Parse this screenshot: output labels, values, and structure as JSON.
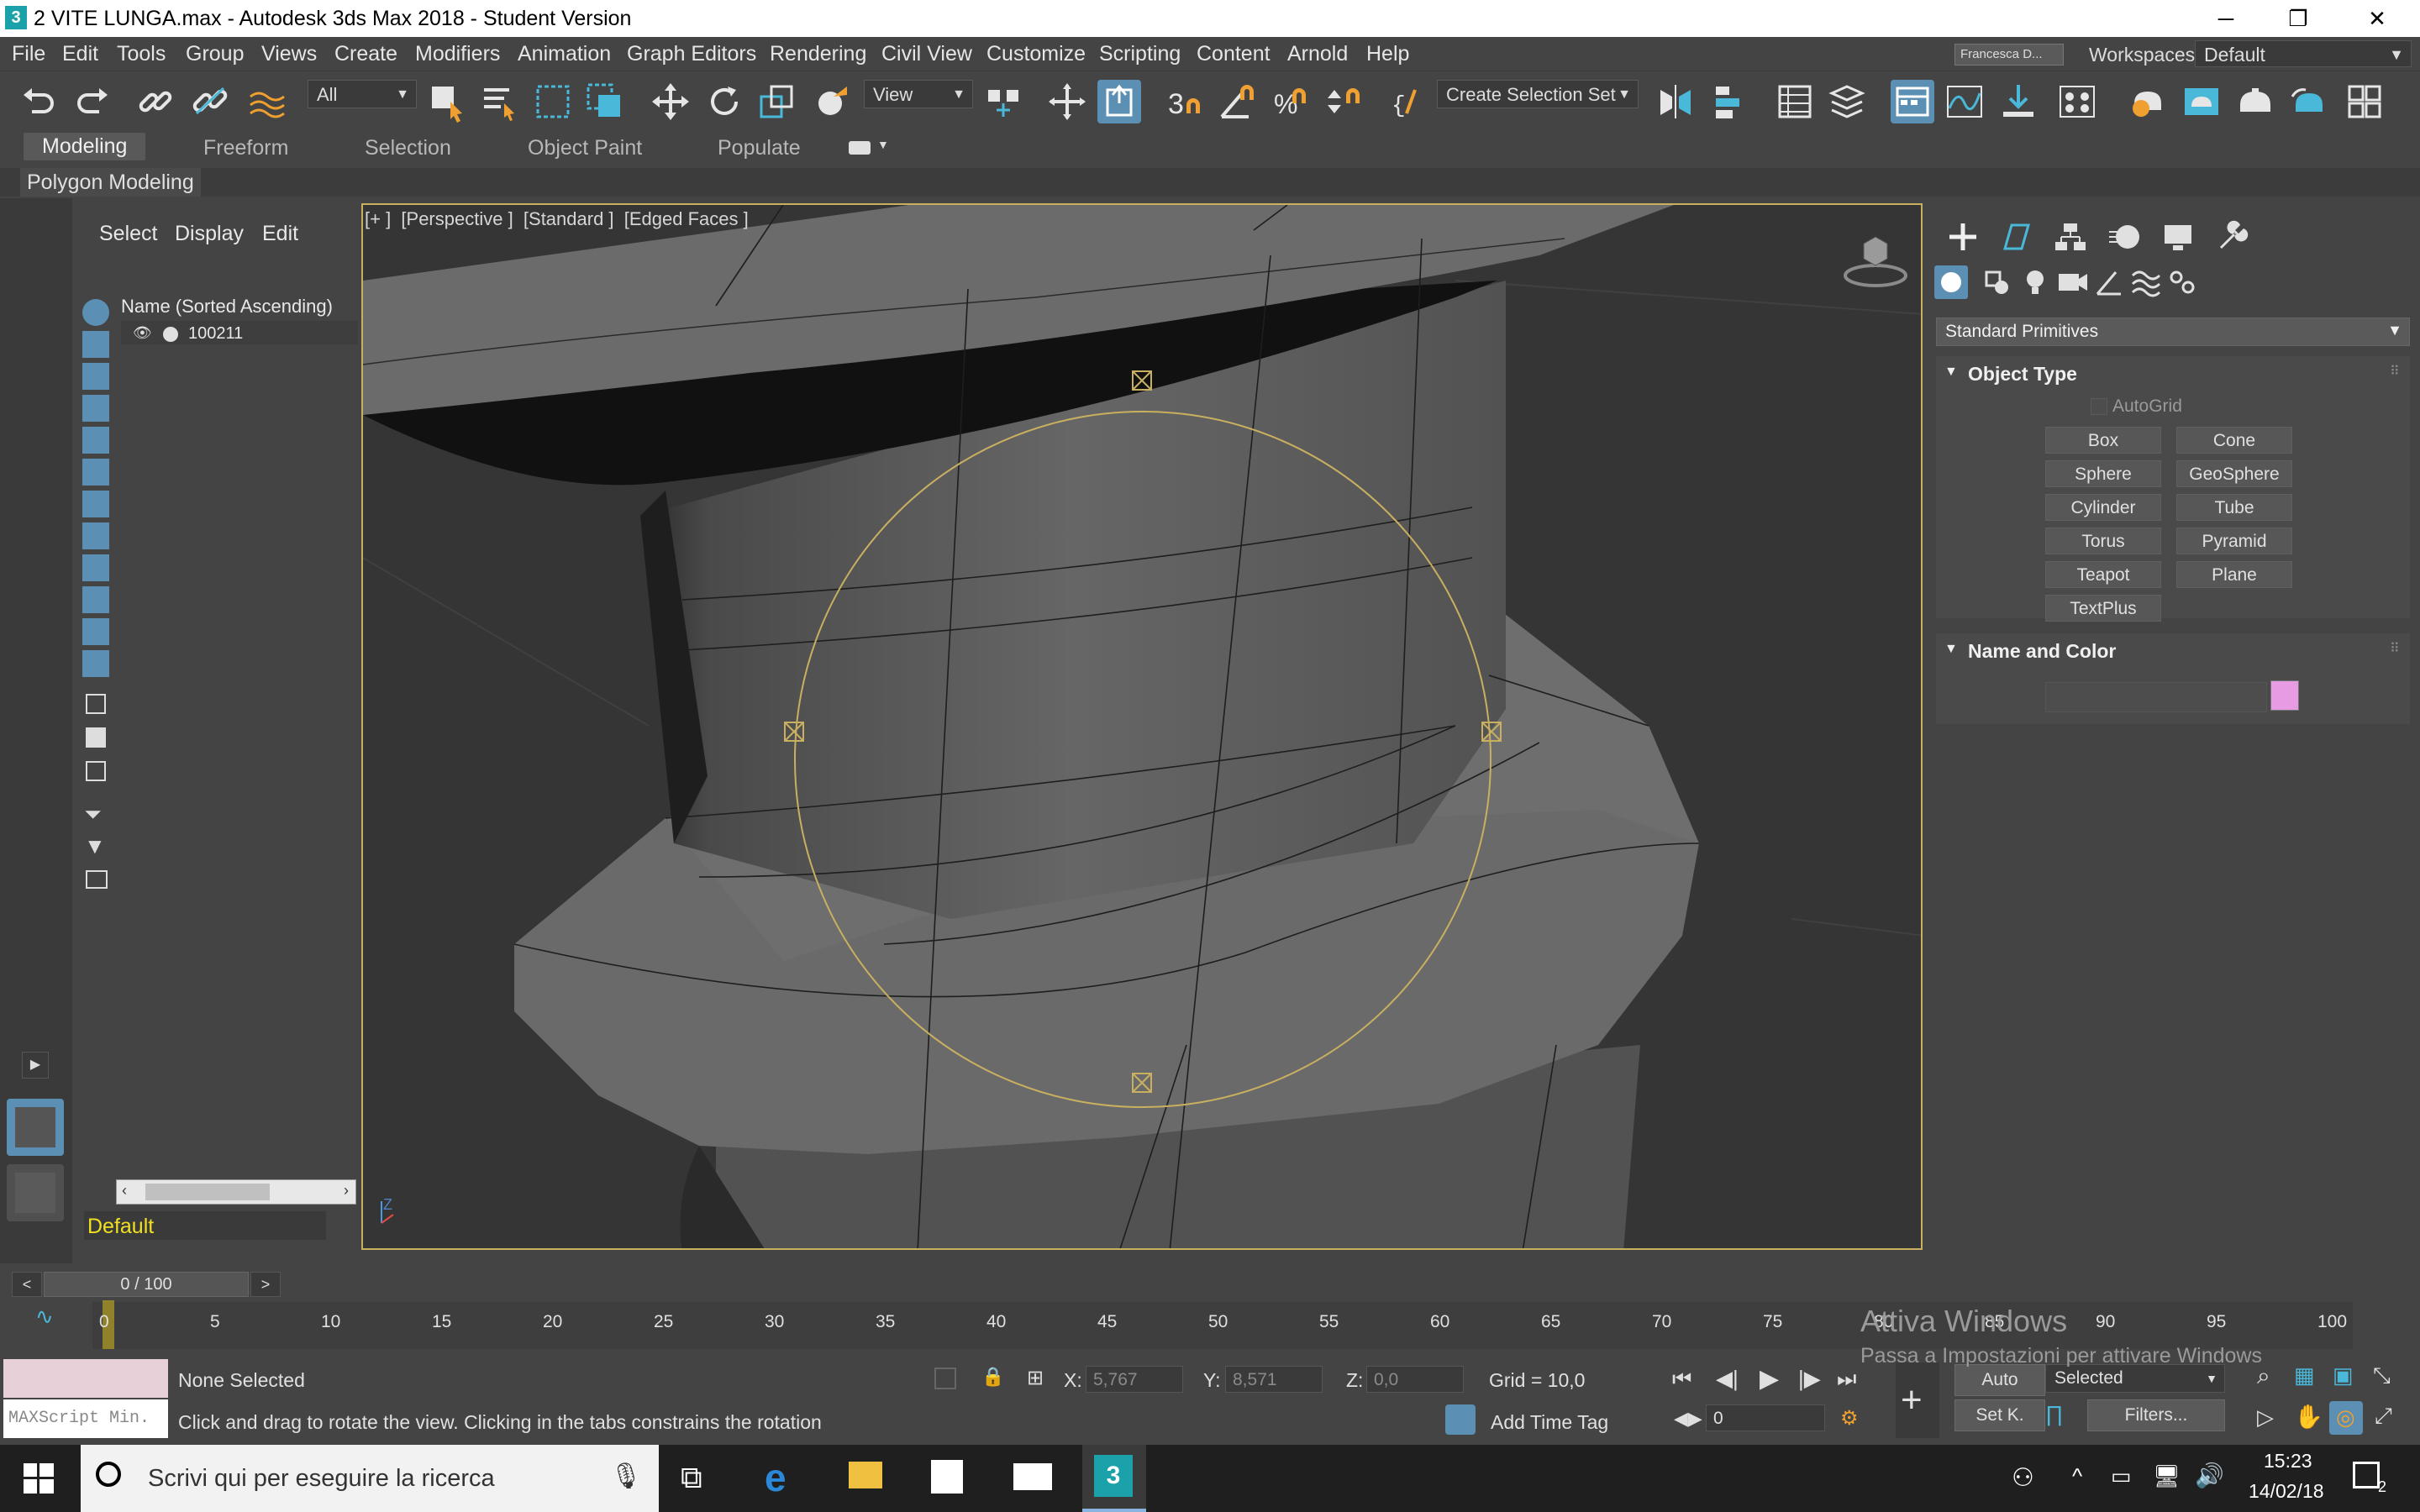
{
  "window": {
    "title": "2 VITE LUNGA.max - Autodesk 3ds Max 2018 - Student Version",
    "app_icon": "3",
    "min": "─",
    "restore": "❐",
    "close": "✕"
  },
  "menu": [
    "File",
    "Edit",
    "Tools",
    "Group",
    "Views",
    "Create",
    "Modifiers",
    "Animation",
    "Graph Editors",
    "Rendering",
    "Civil View",
    "Customize",
    "Scripting",
    "Content",
    "Arnold",
    "Help"
  ],
  "user": "Francesca D...",
  "workspaces": {
    "label": "Workspaces:",
    "value": "Default"
  },
  "toolbar": {
    "filter": "All",
    "refcoord": "View",
    "selection_set": "Create Selection Set"
  },
  "ribbon": {
    "tabs": [
      "Modeling",
      "Freeform",
      "Selection",
      "Object Paint",
      "Populate"
    ],
    "active": "Modeling",
    "sub": "Polygon Modeling"
  },
  "scene_explorer": {
    "tabs": [
      "Select",
      "Display",
      "Edit"
    ],
    "header": "Name (Sorted Ascending)",
    "items": [
      "100211"
    ],
    "layer": "Default"
  },
  "viewport": {
    "label": "[+ ]  [Perspective ]  [Standard ]  [Edged Faces ]"
  },
  "command_panel": {
    "category": "Standard Primitives",
    "object_type_title": "Object Type",
    "autogrid": "AutoGrid",
    "buttons": [
      "Box",
      "Cone",
      "Sphere",
      "GeoSphere",
      "Cylinder",
      "Tube",
      "Torus",
      "Pyramid",
      "Teapot",
      "Plane",
      "TextPlus"
    ],
    "name_color_title": "Name and Color",
    "swatch_color": "#e79be3"
  },
  "timeline": {
    "frame": "0 / 100",
    "ticks": [
      "0",
      "5",
      "10",
      "15",
      "20",
      "25",
      "30",
      "35",
      "40",
      "45",
      "50",
      "55",
      "60",
      "65",
      "70",
      "75",
      "80",
      "85",
      "90",
      "95",
      "100"
    ]
  },
  "status": {
    "maxscript": "MAXScript Min.",
    "selection": "None Selected",
    "prompt": "Click and drag to rotate the view.  Clicking in the tabs constrains the rotation",
    "x_label": "X:",
    "x": "5,767",
    "y_label": "Y:",
    "y": "8,571",
    "z_label": "Z:",
    "z": "0,0",
    "grid": "Grid = 10,0",
    "add_time_tag": "Add Time Tag",
    "auto": "Auto",
    "setk": "Set K.",
    "selected": "Selected",
    "filters": "Filters...",
    "frame_field": "0"
  },
  "watermark": {
    "line1": "Attiva Windows",
    "line2": "Passa a Impostazioni per attivare Windows"
  },
  "taskbar": {
    "search": "Scrivi qui per eseguire la ricerca",
    "time": "15:23",
    "date": "14/02/18",
    "notif": "2"
  }
}
